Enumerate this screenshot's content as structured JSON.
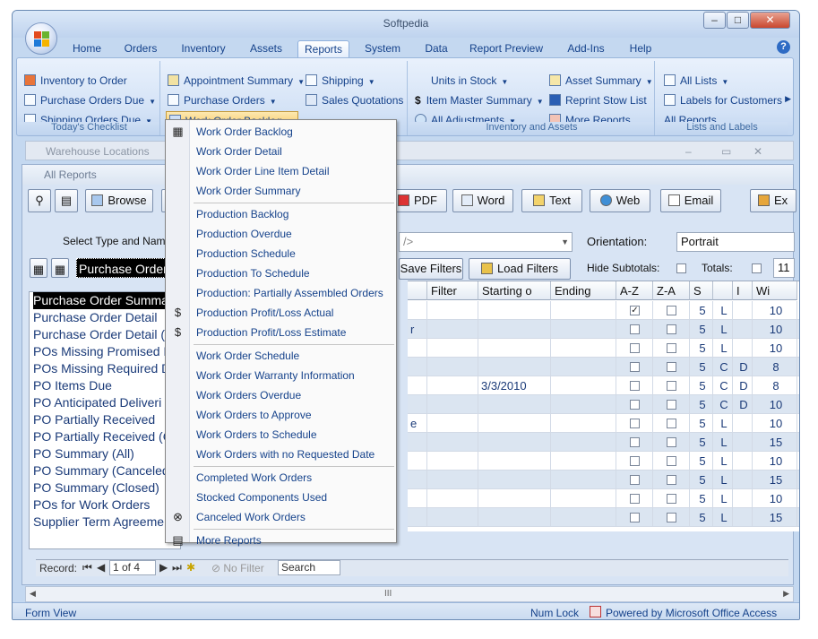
{
  "window": {
    "title": "Softpedia",
    "controls": {
      "minimize": "–",
      "maximize": "□",
      "close": "✕"
    }
  },
  "tabs": [
    "Home",
    "Orders",
    "Inventory",
    "Assets",
    "Reports",
    "System",
    "Data",
    "Report Preview",
    "Add-Ins",
    "Help"
  ],
  "active_tab": "Reports",
  "ribbon": {
    "checklist": {
      "label": "Today's Checklist",
      "items": [
        "Inventory to Order",
        "Purchase Orders Due",
        "Shipping Orders Due"
      ]
    },
    "orders": {
      "items": [
        "Appointment Summary",
        "Purchase Orders",
        "Work Order Backlog",
        "Shipping",
        "Sales Quotations"
      ]
    },
    "inventory": {
      "label": "Inventory and Assets",
      "items": [
        "Units in Stock",
        "Item Master Summary",
        "All Adjustments",
        "Asset Summary",
        "Reprint Stow List",
        "More Reports"
      ]
    },
    "lists": {
      "label": "Lists and Labels",
      "items": [
        "All Lists",
        "Labels for Customers",
        "All Reports"
      ]
    }
  },
  "background_window": {
    "title": "Warehouse Locations"
  },
  "all_reports": {
    "title": "All Reports",
    "toolbar": [
      "Browse",
      "PDF",
      "Word",
      "Text",
      "Web",
      "Email",
      "Ex"
    ],
    "select_label": "Select Type and Name",
    "select_value": "Purchase Orders",
    "combo_partial": "/>",
    "buttons": {
      "save_filters": "Save Filters",
      "load_filters": "Load Filters"
    },
    "orientation_label": "Orientation:",
    "orientation_value": "Portrait",
    "hide_subtotals_label": "Hide Subtotals:",
    "totals_label": "Totals:",
    "totals_value": "11",
    "report_list": [
      "Purchase Order Summary",
      "Purchase Order Detail",
      "Purchase Order Detail (a",
      "POs Missing Promised D",
      "POs Missing Required D",
      "PO Items Due",
      "PO Anticipated Deliveri",
      "PO Partially Received",
      "PO Partially Received (C",
      "PO Summary (All)",
      "PO Summary (Canceled)",
      "PO Summary (Closed)",
      "POs for Work Orders",
      "Supplier Term Agreeme"
    ],
    "grid_headers": [
      "Filter",
      "Starting o",
      "Ending",
      "A-Z",
      "Z-A",
      "S",
      "",
      "I",
      "Wi"
    ],
    "grid_rows": [
      {
        "p": "",
        "start": "",
        "az": true,
        "s": "5",
        "a": "L",
        "b": "",
        "w": "10"
      },
      {
        "p": "r",
        "start": "",
        "az": false,
        "s": "5",
        "a": "L",
        "b": "",
        "w": "10"
      },
      {
        "p": "",
        "start": "",
        "az": false,
        "s": "5",
        "a": "L",
        "b": "",
        "w": "10"
      },
      {
        "p": "",
        "start": "",
        "az": false,
        "s": "5",
        "a": "C",
        "b": "D",
        "w": "8"
      },
      {
        "p": "",
        "start": "3/3/2010",
        "az": false,
        "s": "5",
        "a": "C",
        "b": "D",
        "w": "8"
      },
      {
        "p": "",
        "start": "",
        "az": false,
        "s": "5",
        "a": "C",
        "b": "D",
        "w": "10"
      },
      {
        "p": "e",
        "start": "",
        "az": false,
        "s": "5",
        "a": "L",
        "b": "",
        "w": "10"
      },
      {
        "p": "",
        "start": "",
        "az": false,
        "s": "5",
        "a": "L",
        "b": "",
        "w": "15"
      },
      {
        "p": "",
        "start": "",
        "az": false,
        "s": "5",
        "a": "L",
        "b": "",
        "w": "10"
      },
      {
        "p": "",
        "start": "",
        "az": false,
        "s": "5",
        "a": "L",
        "b": "",
        "w": "15"
      },
      {
        "p": "",
        "start": "",
        "az": false,
        "s": "5",
        "a": "L",
        "b": "",
        "w": "10"
      },
      {
        "p": "",
        "start": "",
        "az": false,
        "s": "5",
        "a": "L",
        "b": "",
        "w": "15"
      }
    ],
    "nav": {
      "record_label": "Record:",
      "record_value": "1 of 4",
      "no_filter": "No Filter",
      "search": "Search"
    },
    "scroll_grip": "III"
  },
  "dropdown_menu": {
    "groups": [
      [
        "Work Order Backlog",
        "Work Order Detail",
        "Work Order Line Item Detail",
        "Work Order Summary"
      ],
      [
        "Production Backlog",
        "Production Overdue",
        "Production Schedule",
        "Production To Schedule",
        "Production: Partially Assembled Orders",
        "Production Profit/Loss Actual",
        "Production Profit/Loss Estimate"
      ],
      [
        "Work Order Schedule",
        "Work Order Warranty Information",
        "Work Orders Overdue",
        "Work Orders to Approve",
        "Work Orders to Schedule",
        "Work Orders with no Requested Date"
      ],
      [
        "Completed Work Orders",
        "Stocked Components Used",
        "Canceled Work Orders"
      ],
      [
        "More Reports"
      ]
    ],
    "dollar_glyph": "$"
  },
  "status": {
    "left": "Form View",
    "num_lock": "Num Lock",
    "powered": "Powered by Microsoft Office Access"
  },
  "colors": {
    "accent": "#15428b",
    "ribbon_bg": "#d3e2f6",
    "selected_bg": "#000000",
    "highlight": "#f9c960"
  }
}
